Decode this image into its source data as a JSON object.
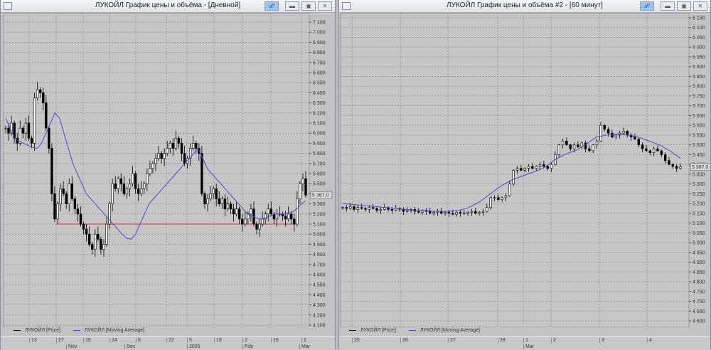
{
  "left_window": {
    "title": "ЛУКОЙЛ График цены и объёма - [Дневной]",
    "legend": [
      "ЛУКОЙЛ [Price]",
      "ЛУКОЙЛ [Moving Average]"
    ],
    "date_ticks": [
      "13",
      "27",
      "10",
      "24",
      "8",
      "22",
      "5",
      "19",
      "2",
      "16",
      "2"
    ],
    "month_labels": [
      "Nov",
      "Dec",
      "2026",
      "Feb",
      "Mar"
    ],
    "last_price_label": "5 387,0"
  },
  "right_window": {
    "title": "ЛУКОЙЛ График цены и объёма #2 - [60 минут]",
    "legend": [
      "ЛУКОЙЛ [Price]",
      "ЛУКОЙЛ [Moving Average]"
    ],
    "date_ticks": [
      "25",
      "26",
      "27",
      "28",
      "1",
      "2",
      "3",
      "4"
    ],
    "month_labels": [
      "Mar"
    ],
    "last_price_label": "5 387,0"
  },
  "colors": {
    "price": "#000000",
    "moving_average": "#4a4acc",
    "support_line": "#e03030",
    "plot_bg": "#c6c6c6"
  },
  "chart_data": [
    {
      "type": "candlestick",
      "title": "ЛУКОЙЛ График цены и объёма - [Дневной]",
      "ylim": [
        4100,
        7100
      ],
      "y_ticks": [
        "7 100",
        "7 000",
        "6 900",
        "6 800",
        "6 700",
        "6 600",
        "6 500",
        "6 400",
        "6 300",
        "6 200",
        "6 100",
        "6 000",
        "5 900",
        "5 800",
        "5 700",
        "5 600",
        "5 500",
        "5 400",
        "5 300",
        "5 200",
        "5 100",
        "5 000",
        "4 900",
        "4 800",
        "4 700",
        "4 600",
        "4 500",
        "4 400",
        "4 300",
        "4 200",
        "4 100"
      ],
      "close": [
        6050,
        6000,
        6100,
        5950,
        5900,
        6050,
        6000,
        6100,
        5950,
        5900,
        6350,
        6430,
        6400,
        6300,
        6050,
        5850,
        5400,
        5150,
        5300,
        5450,
        5400,
        5300,
        5500,
        5350,
        5250,
        5200,
        5100,
        5050,
        5000,
        4900,
        4850,
        5000,
        4950,
        4850,
        4900,
        5100,
        5300,
        5500,
        5450,
        5550,
        5500,
        5400,
        5450,
        5500,
        5600,
        5450,
        5400,
        5450,
        5500,
        5600,
        5650,
        5700,
        5750,
        5800,
        5750,
        5800,
        5850,
        5900,
        5850,
        5950,
        5900,
        5800,
        5700,
        5750,
        5850,
        5900,
        5850,
        5800,
        5400,
        5300,
        5350,
        5400,
        5450,
        5350,
        5300,
        5350,
        5250,
        5300,
        5250,
        5200,
        5250,
        5150,
        5100,
        5150,
        5200,
        5250,
        5100,
        5050,
        5100,
        5150,
        5200,
        5250,
        5200,
        5150,
        5200,
        5200,
        5180,
        5150,
        5200,
        5150,
        5100,
        5350,
        5500,
        5550,
        5387
      ],
      "moving_average": [
        6150,
        6050,
        5950,
        5920,
        5900,
        5880,
        5860,
        5850,
        5900,
        6000,
        6100,
        6200,
        6150,
        6000,
        5850,
        5700,
        5600,
        5500,
        5400,
        5350,
        5300,
        5250,
        5200,
        5150,
        5100,
        5050,
        5000,
        4960,
        4950,
        5000,
        5100,
        5200,
        5300,
        5350,
        5400,
        5450,
        5500,
        5550,
        5600,
        5650,
        5700,
        5750,
        5800,
        5850,
        5750,
        5650,
        5600,
        5550,
        5500,
        5450,
        5400,
        5350,
        5300,
        5250,
        5200,
        5180,
        5160,
        5150,
        5160,
        5180,
        5200,
        5200,
        5200,
        5210,
        5220,
        5250,
        5300,
        5330
      ],
      "support_level": 5100
    },
    {
      "type": "candlestick",
      "title": "ЛУКОЙЛ График цены и объёма #2 - [60 минут]",
      "ylim": [
        4600,
        6150
      ],
      "y_ticks": [
        "6 150",
        "6 100",
        "6 050",
        "6 000",
        "5 950",
        "5 900",
        "5 850",
        "5 800",
        "5 750",
        "5 700",
        "5 650",
        "5 600",
        "5 550",
        "5 500",
        "5 450",
        "5 400",
        "5 350",
        "5 300",
        "5 250",
        "5 200",
        "5 150",
        "5 100",
        "5 050",
        "5 000",
        "4 950",
        "4 900",
        "4 850",
        "4 800",
        "4 750",
        "4 700",
        "4 650",
        "4 600"
      ],
      "close": [
        5180,
        5175,
        5185,
        5170,
        5180,
        5175,
        5170,
        5180,
        5175,
        5165,
        5170,
        5180,
        5170,
        5165,
        5175,
        5170,
        5160,
        5165,
        5170,
        5160,
        5155,
        5165,
        5160,
        5150,
        5155,
        5160,
        5150,
        5155,
        5150,
        5145,
        5155,
        5150,
        5150,
        5155,
        5160,
        5150,
        5155,
        5160,
        5180,
        5230,
        5230,
        5220,
        5230,
        5240,
        5300,
        5370,
        5380,
        5370,
        5380,
        5390,
        5380,
        5390,
        5400,
        5390,
        5380,
        5400,
        5450,
        5500,
        5520,
        5500,
        5480,
        5500,
        5490,
        5510,
        5480,
        5470,
        5500,
        5520,
        5600,
        5580,
        5560,
        5540,
        5550,
        5560,
        5570,
        5550,
        5540,
        5530,
        5500,
        5480,
        5470,
        5460,
        5480,
        5470,
        5450,
        5420,
        5400,
        5390,
        5380,
        5387
      ],
      "moving_average": [
        5200,
        5195,
        5190,
        5185,
        5180,
        5175,
        5170,
        5165,
        5162,
        5160,
        5160,
        5165,
        5180,
        5210,
        5250,
        5290,
        5320,
        5340,
        5360,
        5380,
        5420,
        5450,
        5470,
        5500,
        5540,
        5550,
        5555,
        5550,
        5540,
        5520,
        5500,
        5470,
        5430
      ]
    }
  ]
}
